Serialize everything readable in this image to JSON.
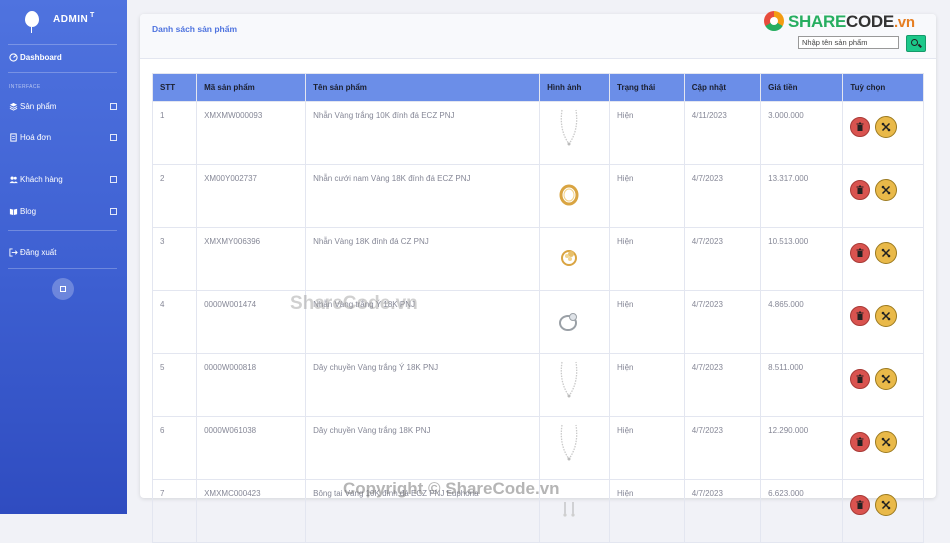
{
  "brand": {
    "title": "ADMIN",
    "sup": "T"
  },
  "sidebar": {
    "dashboard": "Dashboard",
    "section": "INTERFACE",
    "items": [
      {
        "label": "Sản phẩm",
        "icon": "layers-icon"
      },
      {
        "label": "Hoá đơn",
        "icon": "receipt-icon"
      },
      {
        "label": "Khách hàng",
        "icon": "users-icon"
      },
      {
        "label": "Blog",
        "icon": "book-icon"
      }
    ],
    "logout": "Đăng xuất"
  },
  "header": {
    "title": "Danh sách sản phẩm",
    "search_placeholder": "Nhập tên sản phẩm"
  },
  "logo": {
    "share": "SHARE",
    "code": "CODE",
    "vn": ".vn"
  },
  "table": {
    "columns": [
      "STT",
      "Mã sản phẩm",
      "Tên sản phẩm",
      "Hình ảnh",
      "Trạng thái",
      "Cập nhật",
      "Giá tiền",
      "Tuỳ chọn"
    ],
    "rows": [
      {
        "stt": "1",
        "code": "XMXMW000093",
        "name": "Nhẫn Vàng trắng 10K đính đá ECZ PNJ",
        "image": "necklace",
        "status": "Hiện",
        "date": "4/11/2023",
        "price": "3.000.000"
      },
      {
        "stt": "2",
        "code": "XM00Y002737",
        "name": "Nhẫn cưới nam Vàng 18K đính đá ECZ PNJ",
        "image": "ring-gold",
        "status": "Hiện",
        "date": "4/7/2023",
        "price": "13.317.000"
      },
      {
        "stt": "3",
        "code": "XMXMY006396",
        "name": "Nhẫn Vàng 18K đính đá CZ PNJ",
        "image": "ring-flower",
        "status": "Hiện",
        "date": "4/7/2023",
        "price": "10.513.000"
      },
      {
        "stt": "4",
        "code": "0000W001474",
        "name": "Nhẫn Vàng trắng Ý 18K PNJ",
        "image": "ring-silver",
        "status": "Hiện",
        "date": "4/7/2023",
        "price": "4.865.000"
      },
      {
        "stt": "5",
        "code": "0000W000818",
        "name": "Dây chuyền Vàng trắng Ý 18K PNJ",
        "image": "necklace",
        "status": "Hiện",
        "date": "4/7/2023",
        "price": "8.511.000"
      },
      {
        "stt": "6",
        "code": "0000W061038",
        "name": "Dây chuyền Vàng trắng 18K PNJ",
        "image": "necklace",
        "status": "Hiện",
        "date": "4/7/2023",
        "price": "12.290.000"
      },
      {
        "stt": "7",
        "code": "XMXMC000423",
        "name": "Bông tai Vàng 10K đính đá ECZ PNJ Euphoria",
        "image": "earrings",
        "status": "Hiện",
        "date": "4/7/2023",
        "price": "6.623.000"
      }
    ]
  },
  "watermarks": {
    "center": "ShareCode.vn",
    "bottom": "Copyright © ShareCode.vn"
  },
  "colors": {
    "sidebar": "#4e73df",
    "header_row": "#6b8ee8",
    "delete": "#d9534f",
    "edit": "#e9b949",
    "search": "#1cc88a"
  }
}
